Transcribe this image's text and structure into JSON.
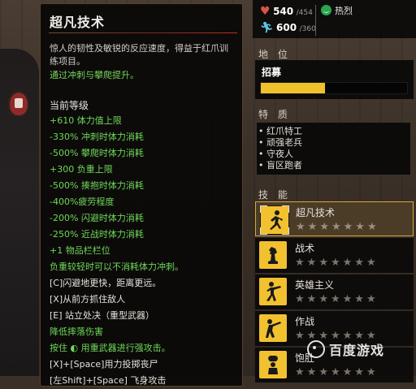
{
  "skill_detail": {
    "title": "超凡技术",
    "description": "惊人的韧性及敏锐的反应速度，得益于红爪训练项目。",
    "upgrade_hint": "通过冲刺与攀爬提升。",
    "current_level_label": "当前等级",
    "bonuses": [
      {
        "text": "+610 体力值上限",
        "color": "green"
      },
      {
        "text": "-330% 冲刺时体力消耗",
        "color": "green"
      },
      {
        "text": "-500% 攀爬时体力消耗",
        "color": "green"
      },
      {
        "text": "+300 负重上限",
        "color": "green"
      },
      {
        "text": "-500% 揍抱时体力消耗",
        "color": "green"
      },
      {
        "text": "-400%疲劳程度",
        "color": "green"
      },
      {
        "text": "-200% 闪避时体力消耗",
        "color": "green"
      },
      {
        "text": "-250% 近战时体力消耗",
        "color": "green"
      },
      {
        "text": "+1 物品栏栏位",
        "color": "green"
      },
      {
        "text": "负重较轻时可以不消耗体力冲刺。",
        "color": "green"
      },
      {
        "text": "[C]闪避地更快，距离更远。",
        "color": "white"
      },
      {
        "text": "[X]从前方抓住敌人",
        "color": "white"
      },
      {
        "text": "[E] 站立处决（重型武器）",
        "color": "white"
      },
      {
        "text": "降低摔落伤害",
        "color": "green"
      },
      {
        "text": "按住 ◐ 用重武器进行强攻击。",
        "color": "green"
      },
      {
        "text": "[X]+[Space]用力投掷丧尸",
        "color": "white"
      },
      {
        "text": "[左Shift]+[Space] 飞身攻击",
        "color": "white"
      }
    ]
  },
  "stats": {
    "health_value": "540",
    "health_max": "/454",
    "stamina_value": "600",
    "stamina_max": "/360",
    "mood_label": "热烈",
    "colors": {
      "health": "#d9544a",
      "stamina": "#5cc6e8",
      "mood": "#2aa54e"
    }
  },
  "rank": {
    "section_title": "地 位",
    "label": "招募",
    "progress": 0.44,
    "bar_color": "#efc12a"
  },
  "traits": {
    "section_title": "特 质",
    "items": [
      "红爪特工",
      "顽强老兵",
      "守夜人",
      "盲区跑者"
    ]
  },
  "skills": {
    "section_title": "技 能",
    "items": [
      {
        "name": "超凡技术",
        "stars_filled": 0,
        "stars_total": 7,
        "icon": "running-man-icon",
        "active": true
      },
      {
        "name": "战术",
        "stars_filled": 0,
        "stars_total": 7,
        "icon": "chess-piece-icon",
        "active": false
      },
      {
        "name": "英雄主义",
        "stars_filled": 0,
        "stars_total": 7,
        "icon": "martial-arts-icon",
        "active": false
      },
      {
        "name": "作战",
        "stars_filled": 0,
        "stars_total": 7,
        "icon": "shooter-icon",
        "active": false
      },
      {
        "name": "饱肚",
        "stars_filled": 0,
        "stars_total": 7,
        "icon": "chef-icon",
        "active": false
      }
    ]
  },
  "watermark": {
    "text": "百度游戏"
  }
}
